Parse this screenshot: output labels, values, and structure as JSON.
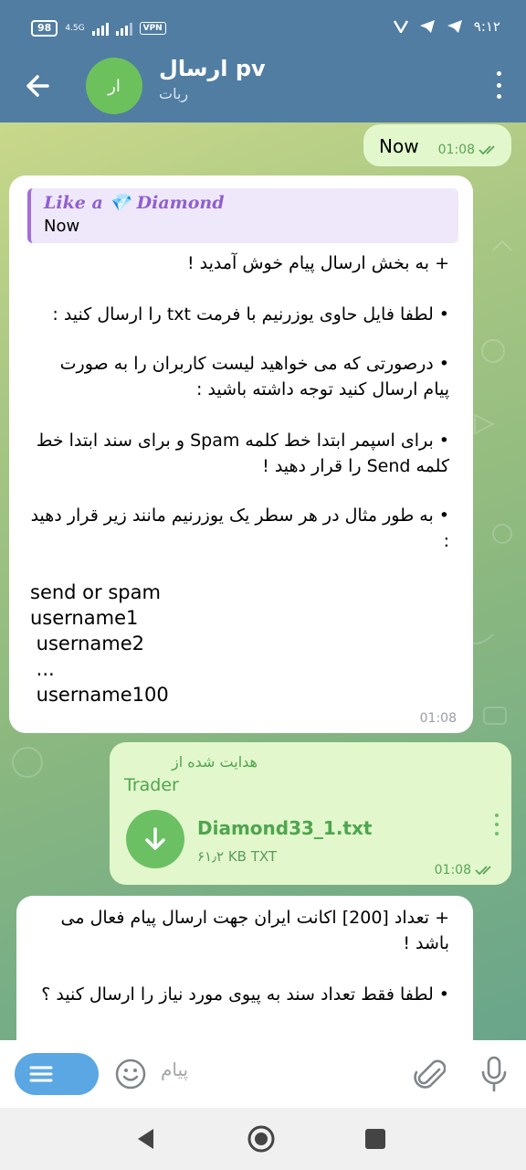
{
  "status_bar": {
    "battery": "98",
    "network": "4.5G",
    "vpn": "VPN",
    "time": "۹:۱۲"
  },
  "header": {
    "title": "ارسال pv",
    "subtitle": "ربات",
    "avatar_initials": "ار",
    "avatar_color": "#6cc15c",
    "header_color": "#517da2"
  },
  "messages": {
    "m1": {
      "text": "Now",
      "time": "01:08"
    },
    "m2": {
      "reply_name": "Like a 💎 Diamond",
      "reply_text": "Now",
      "p1": "+ به بخش ارسال پیام خوش آمدید !",
      "p2": "• لطفا فایل حاوی یوزرنیم با فرمت txt را ارسال کنید :",
      "p3": "• درصورتی که می خواهید لیست کاربران را به صورت پیام ارسال کنید توجه داشته باشید :",
      "p4": "• برای اسپمر ابتدا خط کلمه Spam و برای سند ابتدا خط کلمه Send را قرار دهید !",
      "p5": "• به طور مثال در هر سطر یک یوزرنیم مانند زیر قرار دهید :",
      "code1": "send or spam",
      "code2": "username1",
      "code3": " username2",
      "code4": " ...",
      "code5": " username100",
      "time": "01:08"
    },
    "m3": {
      "forwarded_label": "هدایت شده از",
      "forwarded_from": "Trader",
      "file_name": "Diamond33_1.txt",
      "file_size": "۶۱٫۲ KB TXT",
      "time": "01:08"
    },
    "m4": {
      "p1": "+ تعداد [200] اکانت ایران جهت ارسال پیام فعال می باشد !",
      "p2": "• لطفا فقط تعداد سند به پیوی مورد نیاز را ارسال کنید ؟"
    }
  },
  "input": {
    "placeholder": "پیام"
  }
}
